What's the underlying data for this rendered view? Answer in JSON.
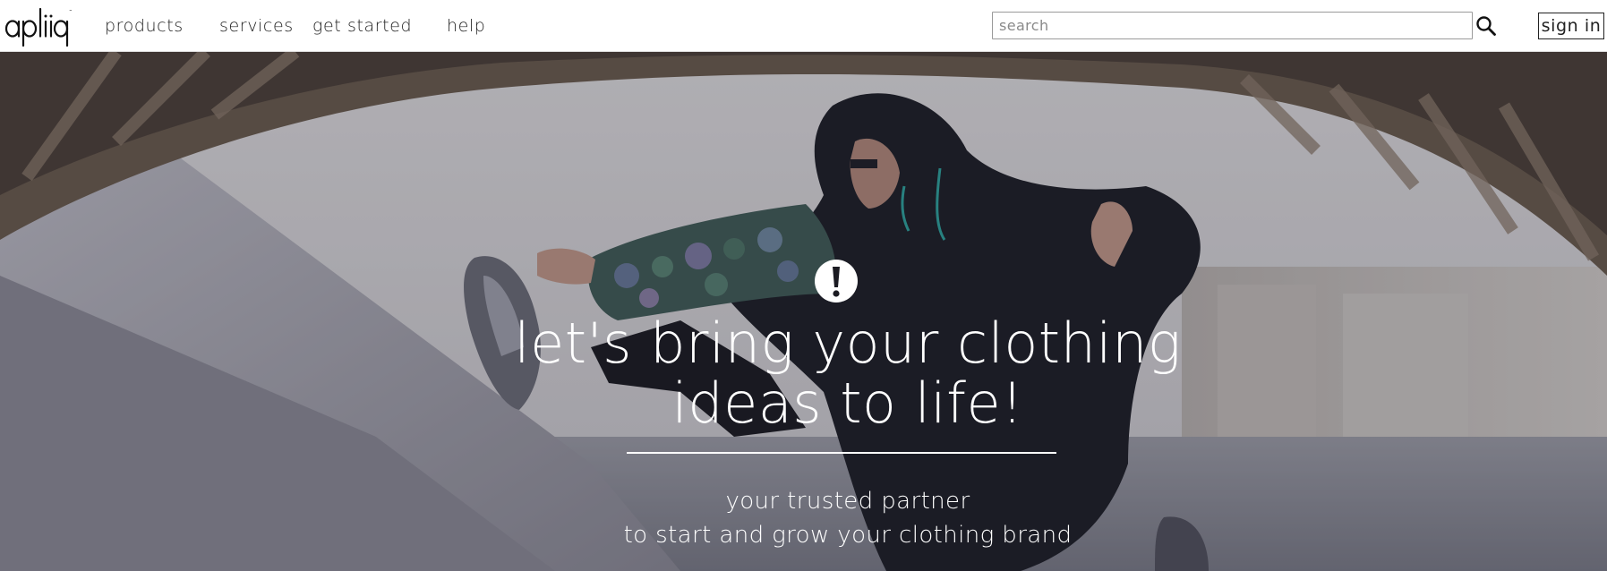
{
  "brand": {
    "logo_text": "apliiq"
  },
  "nav": {
    "items": [
      {
        "id": "products",
        "label": "products"
      },
      {
        "id": "services",
        "label": "services"
      },
      {
        "id": "get-started",
        "label": "get started"
      },
      {
        "id": "help",
        "label": "help"
      }
    ]
  },
  "search": {
    "placeholder": "search",
    "value": "",
    "icon": "search-icon"
  },
  "account": {
    "sign_in_label": "sign in"
  },
  "hero": {
    "alert_icon": "exclamation-circle-icon",
    "title_line1": "let's bring your clothing",
    "title_line2": "ideas to life!",
    "subtitle_line1": "your trusted partner",
    "subtitle_line2": "to start and grow your clothing brand"
  },
  "colors": {
    "text_dark": "#222222",
    "hero_text": "#ffffff",
    "header_bg": "#ffffff"
  }
}
